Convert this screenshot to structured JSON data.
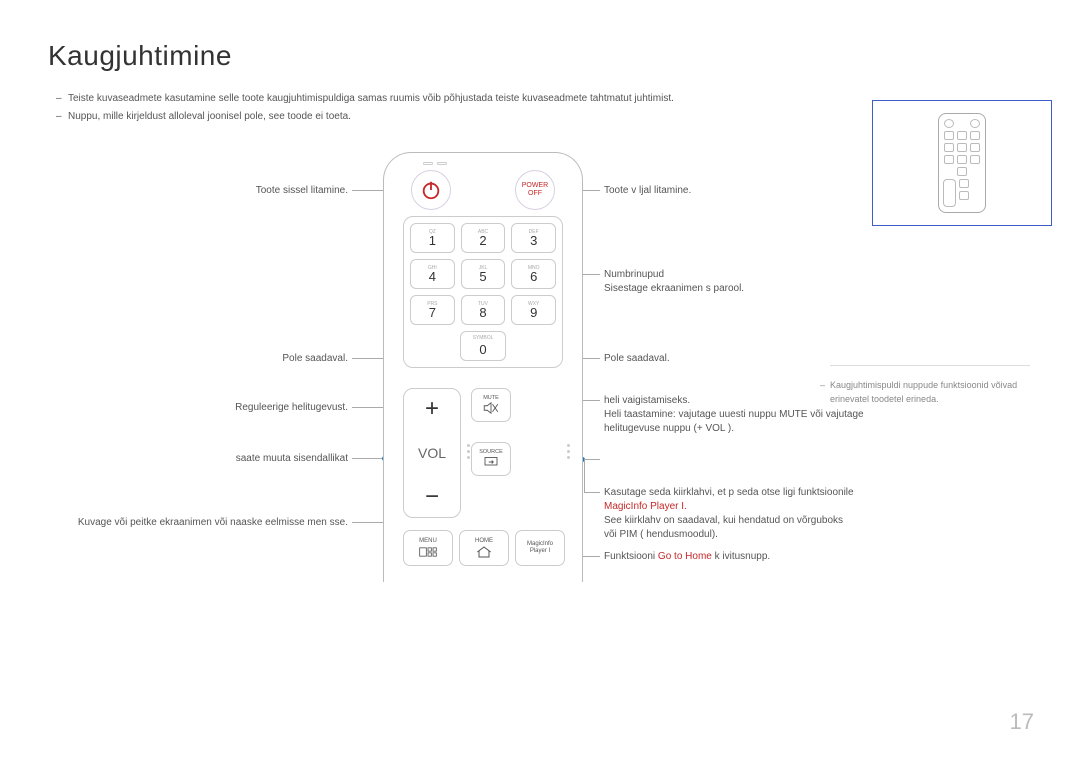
{
  "title": "Kaugjuhtimine",
  "intro": [
    "Teiste kuvaseadmete kasutamine selle toote kaugjuhtimispuldiga samas ruumis võib põhjustada teiste kuvaseadmete tahtmatut juhtimist.",
    "Nuppu, mille kirjeldust alloleval joonisel pole, see toode ei toeta."
  ],
  "left": {
    "power_on": "Toote sissel litamine.",
    "unavailable": "Pole saadaval.",
    "volume": "Reguleerige helitugevust.",
    "source": "saate muuta sisendallikat",
    "menu": "Kuvage või peitke ekraanimen  või naaske eelmisse men sse."
  },
  "right": {
    "power_off": "Toote v ljal litamine.",
    "numbers_1": "Numbrinupud",
    "numbers_2": "Sisestage ekraanimen s parool.",
    "unavailable": "Pole saadaval.",
    "mute_1": "heli vaigistamiseks.",
    "mute_2": "Heli taastamine: vajutage uuesti nuppu MUTE või vajutage helitugevuse nuppu (+ VOL  ).",
    "magic_1a": "Kasutage seda kiirklahvi, et p seda otse ligi funktsioonile",
    "magic_1b": "MagicInfo Player I.",
    "magic_2": "See kiirklahv on saadaval, kui  hendatud on võrguboks või PIM ( hendusmoodul).",
    "home_a": "Funktsiooni ",
    "home_b": "Go to Home",
    "home_c": " k ivitusnupp."
  },
  "remote": {
    "power_off": [
      "POWER",
      "OFF"
    ],
    "keys": [
      [
        "QZ",
        "1"
      ],
      [
        "ABC",
        "2"
      ],
      [
        "DEF",
        "3"
      ],
      [
        "GHI",
        "4"
      ],
      [
        "JKL",
        "5"
      ],
      [
        "MNO",
        "6"
      ],
      [
        "PRS",
        "7"
      ],
      [
        "TUV",
        "8"
      ],
      [
        "WXY",
        "9"
      ],
      [
        "SYMBOL",
        "0"
      ]
    ],
    "vol": "VOL",
    "mute": "MUTE",
    "source": "SOURCE",
    "menu": "MENU",
    "home": "HOME",
    "magicinfo": [
      "MagicInfo",
      "Player I"
    ]
  },
  "sidenote": "Kaugjuhtimispuldi nuppude funktsioonid võivad erinevatel toodetel erineda.",
  "page_number": "17"
}
